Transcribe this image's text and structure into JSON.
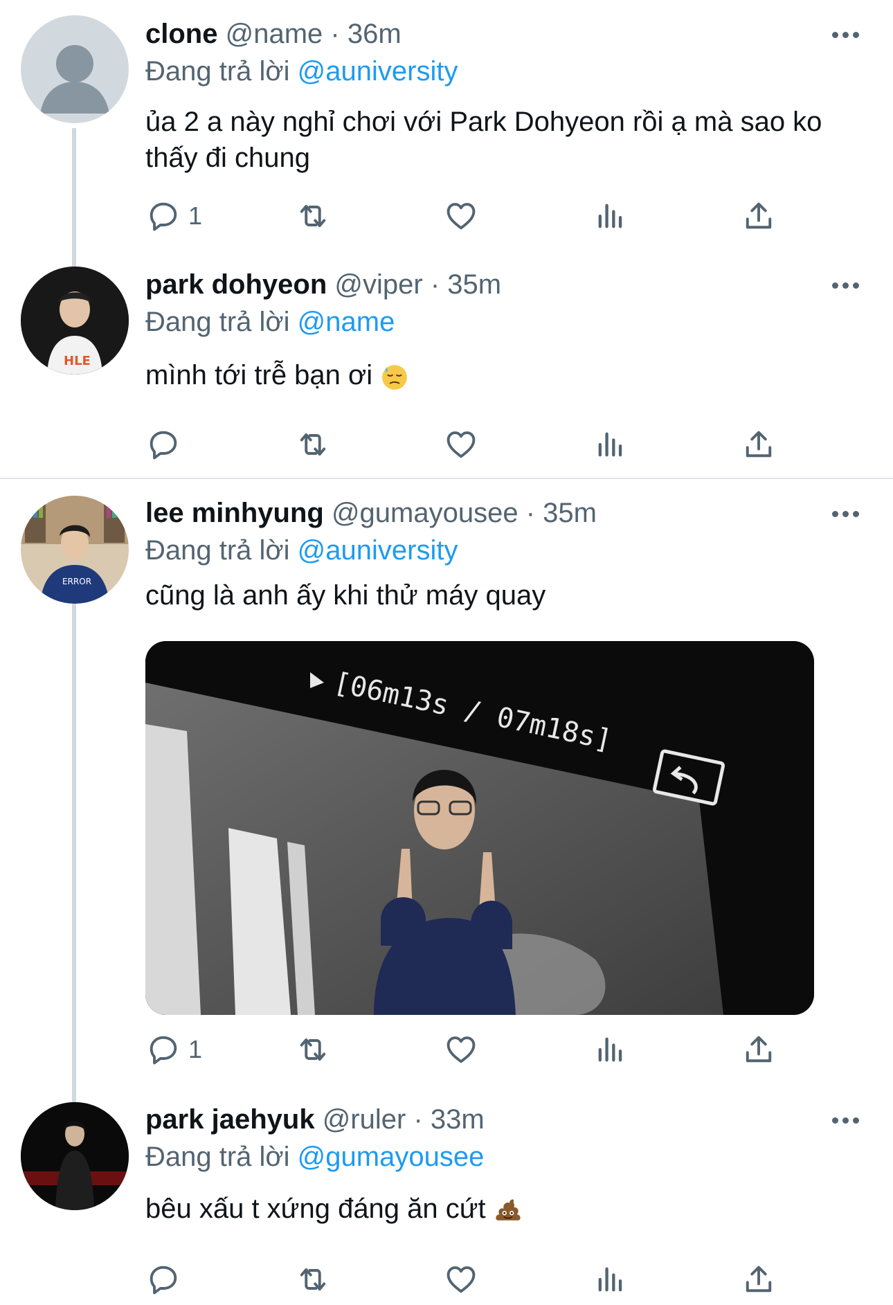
{
  "tweets": [
    {
      "name": "clone",
      "handle": "@name",
      "time": "36m",
      "reply_prefix": "Đang trả lời",
      "reply_to": "@auniversity",
      "text": "ủa 2 a này nghỉ chơi với Park Dohyeon rồi ạ mà sao ko thấy đi chung",
      "reply_count": "1"
    },
    {
      "name": "park dohyeon",
      "handle": "@viper",
      "time": "35m",
      "reply_prefix": "Đang trả lời",
      "reply_to": "@name",
      "text": "mình tới trễ bạn ơi",
      "emoji": "downcast-sweat-face",
      "reply_count": ""
    },
    {
      "name": "lee minhyung",
      "handle": "@gumayousee",
      "time": "35m",
      "reply_prefix": "Đang trả lời",
      "reply_to": "@auniversity",
      "text": "cũng là anh ấy khi thử máy quay",
      "media_overlay_text": "[06m13s / 07m18s]",
      "reply_count": "1"
    },
    {
      "name": "park jaehyuk",
      "handle": "@ruler",
      "time": "33m",
      "reply_prefix": "Đang trả lời",
      "reply_to": "@gumayousee",
      "text": "bêu xấu t xứng đáng ăn cứt",
      "emoji": "pile-of-poo",
      "reply_count": ""
    }
  ],
  "header_separator": "·",
  "colors": {
    "accent": "#1d9bf0",
    "secondary_text": "#536471",
    "icon": "#536471",
    "thread_line": "#cfd9de"
  }
}
